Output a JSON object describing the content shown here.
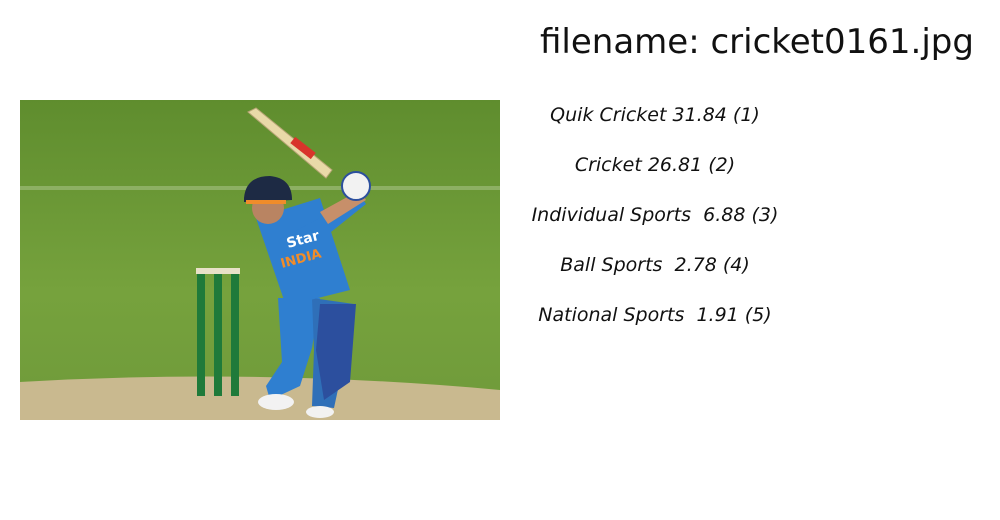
{
  "header": {
    "filename_label": "filename: cricket0161.jpg"
  },
  "image": {
    "subject": "cricket batsman photo",
    "alt": ""
  },
  "predictions": [
    {
      "text": "Quik Cricket 31.84 (1)"
    },
    {
      "text": "Cricket 26.81 (2)"
    },
    {
      "text": "Individual Sports  6.88 (3)"
    },
    {
      "text": "Ball Sports  2.78 (4)"
    },
    {
      "text": "National Sports  1.91 (5)"
    }
  ],
  "colors": {
    "grass": "#6f9a3a",
    "pitch": "#c9b98f",
    "jersey": "#2f7fd0",
    "stumps": "#1f7a3a"
  }
}
